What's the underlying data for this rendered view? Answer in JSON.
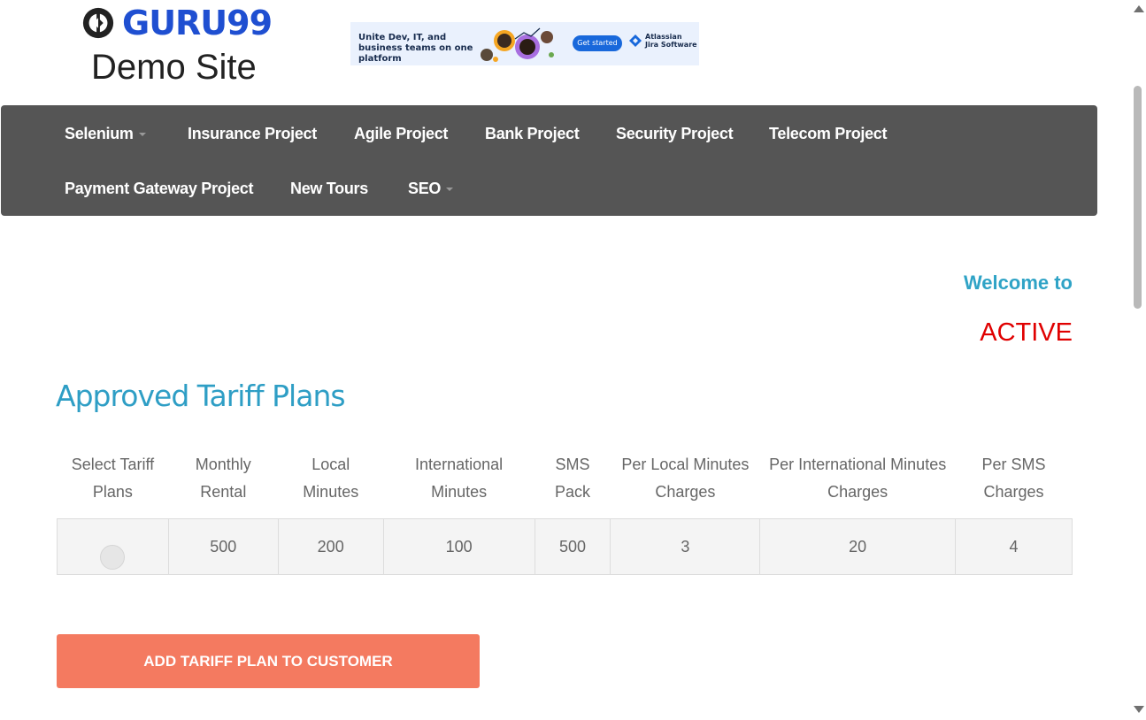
{
  "header": {
    "logo_text": "GURU99",
    "logo_subtitle": "Demo Site"
  },
  "ad": {
    "headline": "Unite Dev, IT, and business teams on one platform",
    "cta": "Get started",
    "brand_line1": "Atlassian",
    "brand_line2": "Jira Software"
  },
  "nav": {
    "items": [
      {
        "label": "Selenium",
        "dropdown": true
      },
      {
        "label": "Insurance Project",
        "dropdown": false
      },
      {
        "label": "Agile Project",
        "dropdown": false
      },
      {
        "label": "Bank Project",
        "dropdown": false
      },
      {
        "label": "Security Project",
        "dropdown": false
      },
      {
        "label": "Telecom Project",
        "dropdown": false
      },
      {
        "label": "Payment Gateway Project",
        "dropdown": false
      },
      {
        "label": "New Tours",
        "dropdown": false
      },
      {
        "label": "SEO",
        "dropdown": true
      }
    ]
  },
  "welcome": {
    "text": "Welcome to",
    "status": "ACTIVE"
  },
  "page_title": "Approved Tariff Plans",
  "table": {
    "headers": [
      "Select Tariff Plans",
      "Monthly Rental",
      "Local Minutes",
      "International Minutes",
      "SMS Pack",
      "Per Local Minutes Charges",
      "Per International Minutes Charges",
      "Per SMS Charges"
    ],
    "rows": [
      {
        "monthly_rental": "500",
        "local_minutes": "200",
        "international_minutes": "100",
        "sms_pack": "500",
        "per_local": "3",
        "per_international": "20",
        "per_sms": "4"
      }
    ]
  },
  "submit_label": "ADD TARIFF PLAN TO CUSTOMER",
  "colors": {
    "nav_bg": "#555555",
    "accent_blue": "#2e9ec5",
    "status_red": "#e00000",
    "button": "#f47a60",
    "logo_blue": "#1f4fd1"
  }
}
